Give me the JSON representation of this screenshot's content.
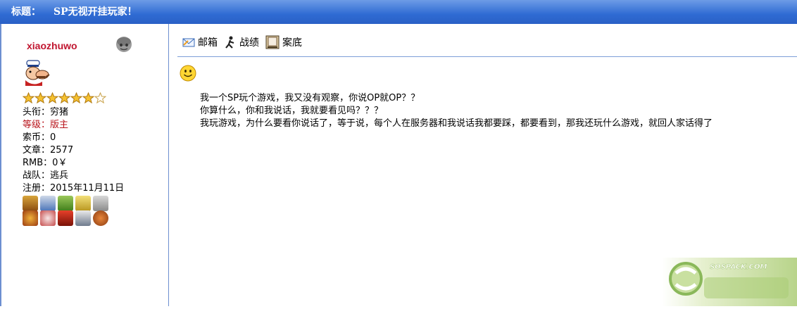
{
  "header": {
    "label": "标题：",
    "title": "SP无视开挂玩家！"
  },
  "user": {
    "name": "xiaozhuwo",
    "status_icon": "offline-user-icon",
    "avatar_icon": "popeye-sailor-icon",
    "stars_filled": 6,
    "stars_total": 7,
    "fields": [
      {
        "label": "头衔：",
        "value": "穷猪",
        "highlight": false
      },
      {
        "label": "等级：",
        "value": "版主",
        "highlight": true
      },
      {
        "label": "索币：",
        "value": "0",
        "highlight": false
      },
      {
        "label": "文章：",
        "value": "2577",
        "highlight": false
      },
      {
        "label": "RMB：",
        "value": "0￥",
        "highlight": false
      },
      {
        "label": "战队：",
        "value": "逃兵",
        "highlight": false
      },
      {
        "label": "注册：",
        "value": "2015年11月11日",
        "highlight": false
      }
    ],
    "medals": [
      "medal-1",
      "medal-2",
      "medal-3",
      "medal-4",
      "medal-5",
      "medal-6",
      "medal-7",
      "medal-8",
      "medal-9",
      "medal-10"
    ]
  },
  "toolbar": {
    "mailbox": "邮箱",
    "record": "战绩",
    "file": "案底"
  },
  "post": {
    "emoticon": "smiley-icon",
    "lines": [
      "我一个SP玩个游戏，我又没有观察，你说OP就OP？？",
      "你算什么，你和我说话，我就要看见吗？？？",
      "我玩游戏，为什么要看你说话了，等于说，每个人在服务器和我说话我都要踩，都要看到，那我还玩什么游戏，就回人家话得了"
    ]
  },
  "watermark": {
    "text": "SOSPACK.COM"
  },
  "colors": {
    "title_bar": "#2f6bd3",
    "username": "#c0152f",
    "level": "#b8141b",
    "divider": "#6d8fd0"
  }
}
